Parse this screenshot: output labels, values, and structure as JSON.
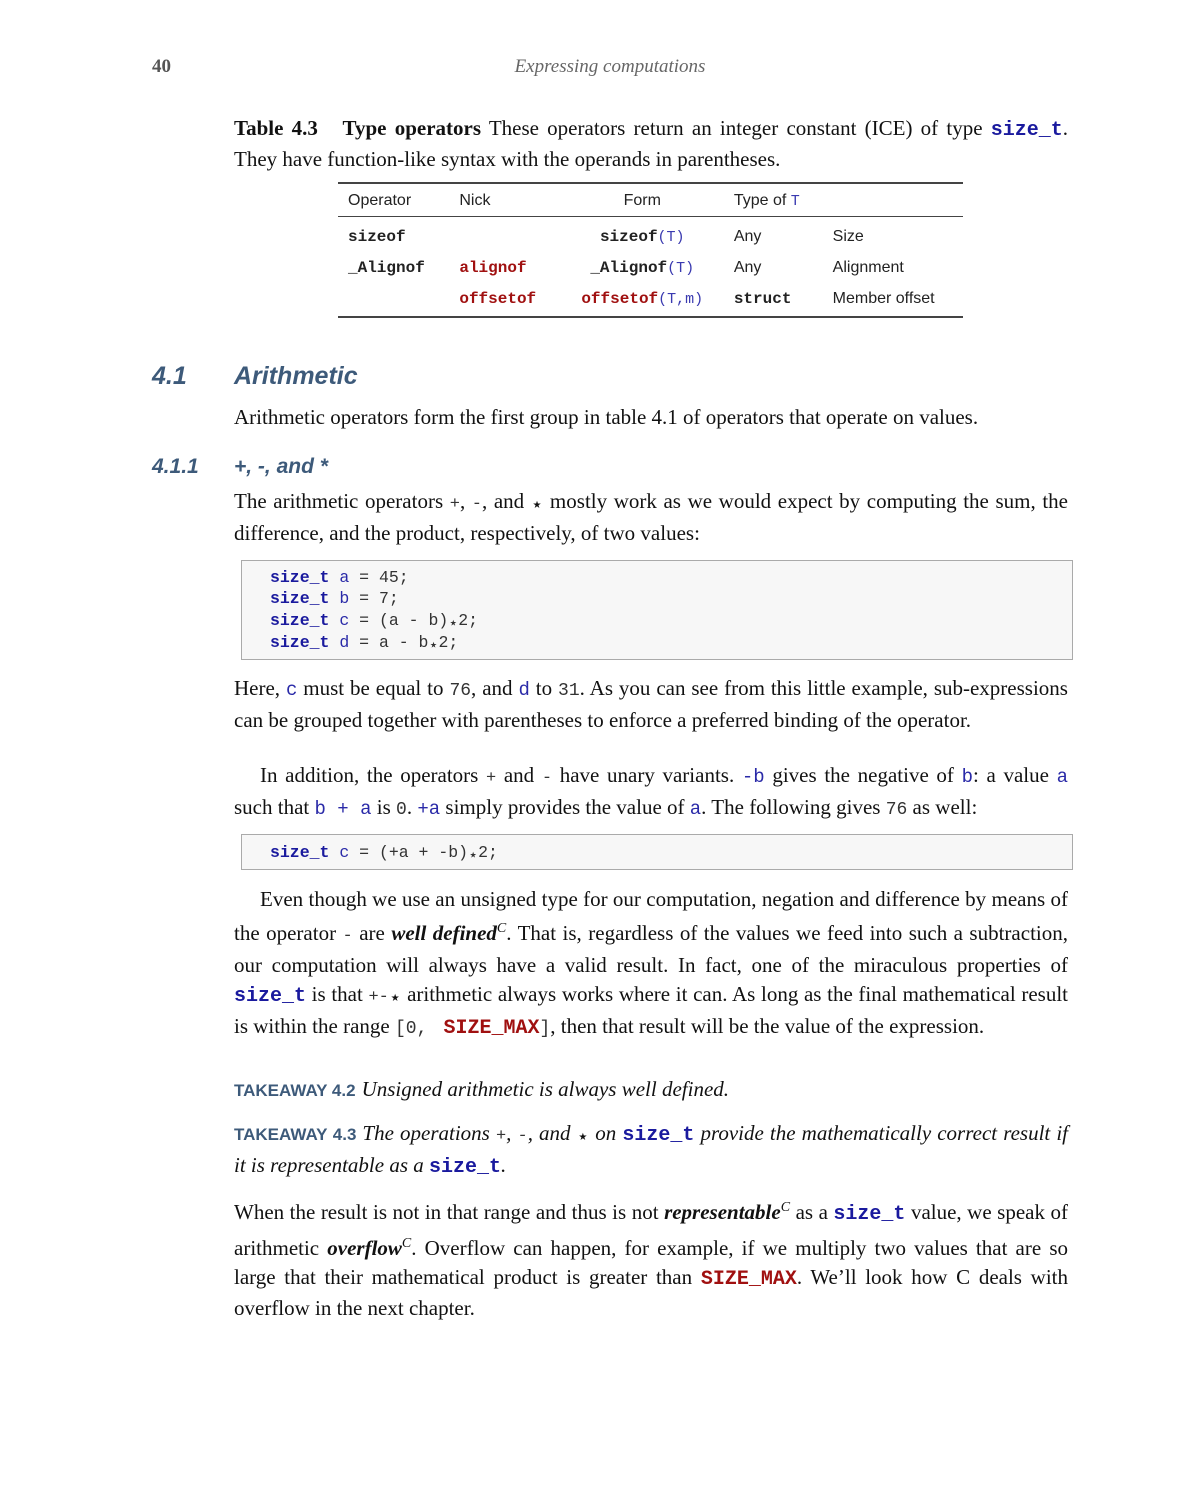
{
  "header": {
    "page_number": "40",
    "running_title": "Expressing computations"
  },
  "table_caption": {
    "label": "Table 4.3",
    "title": "Type operators",
    "text_1": " These operators return an integer constant (ICE) of type ",
    "type_name": "size_t",
    "text_2": ". They have function-like syntax with the operands in parentheses."
  },
  "type_table": {
    "headers": {
      "operator": "Operator",
      "nick": "Nick",
      "form": "Form",
      "type_of": "Type of ",
      "type_of_var": "T",
      "description": ""
    },
    "rows": [
      {
        "operator": "sizeof",
        "nick": "",
        "form_fn": "sizeof",
        "form_fn_style": "plain",
        "form_args": "(T)",
        "type": "Any",
        "type_style": "text",
        "description": "Size"
      },
      {
        "operator": "_Alignof",
        "nick": "alignof",
        "form_fn": "_Alignof",
        "form_fn_style": "plain",
        "form_args": "(T)",
        "type": "Any",
        "type_style": "text",
        "description": "Alignment"
      },
      {
        "operator": "",
        "nick": "offsetof",
        "form_fn": "offsetof",
        "form_fn_style": "red",
        "form_args": "(T,m)",
        "type": "struct",
        "type_style": "code",
        "description": "Member offset"
      }
    ]
  },
  "section": {
    "number": "4.1",
    "title": "Arithmetic",
    "intro": "Arithmetic operators form the first group in table 4.1 of operators that operate on values."
  },
  "subsection": {
    "number": "4.1.1",
    "title": "+, -, and *"
  },
  "para1": {
    "t1": "The arithmetic operators ",
    "plus": "+",
    "t2": ", ",
    "minus": "-",
    "t3": ", and ",
    "star": "⋆",
    "t4": " mostly work as we would expect by computing the sum, the difference, and the product, respectively, of two values:"
  },
  "code_block_1": {
    "lines": [
      {
        "type": "size_t",
        "var": "a",
        "rest": " = 45;"
      },
      {
        "type": "size_t",
        "var": "b",
        "rest": " = 7;"
      },
      {
        "type": "size_t",
        "var": "c",
        "rest": " = (a - b)",
        "star": "⋆",
        "tail": "2;"
      },
      {
        "type": "size_t",
        "var": "d",
        "rest": " = a - b",
        "star": "⋆",
        "tail": "2;"
      }
    ]
  },
  "para2": {
    "t1": "Here, ",
    "v1": "c",
    "t2": " must be equal to ",
    "n1": "76",
    "t3": ", and ",
    "v2": "d",
    "t4": " to ",
    "n2": "31",
    "t5": ".  As you can see from this little example, sub-expressions can be grouped together with parentheses to enforce a preferred binding of the operator."
  },
  "para3": {
    "t1": "In addition, the operators ",
    "plus": "+",
    "t2": " and ",
    "minus": "-",
    "t3": " have unary variants. ",
    "neg_b": "-b",
    "t4": " gives the negative of ",
    "v_b": "b",
    "t5": ": a value ",
    "v_a": "a",
    "t6": " such that ",
    "expr": "b + a",
    "t7": " is ",
    "zero": "0",
    "t8": ". ",
    "pos_a": "+a",
    "t9": " simply provides the value of ",
    "v_a2": "a",
    "t10": ". The following gives ",
    "n76": "76",
    "t11": " as well:"
  },
  "code_block_2": {
    "lines": [
      {
        "type": "size_t",
        "var": "c",
        "rest": " = (+a + -b)",
        "star": "⋆",
        "tail": "2;"
      }
    ]
  },
  "para4": {
    "t1": "Even though we use an unsigned type for our computation, negation and difference by means of the operator ",
    "minus": "-",
    "t2": " are ",
    "term": "well defined",
    "sup": "C",
    "t3": ". That is, regardless of the values we feed into such a subtraction, our computation will always have a valid result. In fact, one of the miraculous properties of ",
    "type_name": "size_t",
    "t4": " is that ",
    "ops": "+-",
    "star": "⋆",
    "t5": " arithmetic always works where it can. As long as the final mathematical result is within the range ",
    "range_open": "[0, ",
    "macro": "SIZE_MAX",
    "range_close": "]",
    "t6": ", then that result will be the value of the expression."
  },
  "takeaways": [
    {
      "label": "TAKEAWAY 4.2",
      "text": "Unsigned arithmetic is always well defined."
    },
    {
      "label": "TAKEAWAY 4.3",
      "t1": "The operations ",
      "plus": "+",
      "t2": ", ",
      "minus": "-",
      "t3": ", and ",
      "star": "⋆",
      "t4": " on ",
      "type_name": "size_t",
      "t5": " provide the mathematically correct result if it is representable as a ",
      "type_name2": "size_t",
      "t6": "."
    }
  ],
  "para5": {
    "t1": "When the result is not in that range and thus is not ",
    "term1": "representable",
    "sup1": "C",
    "t2": " as a ",
    "type_name": "size_t",
    "t3": " value, we speak of arithmetic ",
    "term2": "overflow",
    "sup2": "C",
    "t4": ". Overflow can happen, for example, if we multiply two values that are so large that their mathematical product is greater than ",
    "macro": "SIZE_MAX",
    "t5": ". We’ll look how C deals with overflow in the next chapter."
  },
  "colors": {
    "heading": "#3d5a7a",
    "keyword": "#1a1a9e",
    "macro": "#a01010",
    "variable": "#2a2aa8",
    "code_bg": "#f7f7f7",
    "code_border": "#aaaaaa"
  }
}
